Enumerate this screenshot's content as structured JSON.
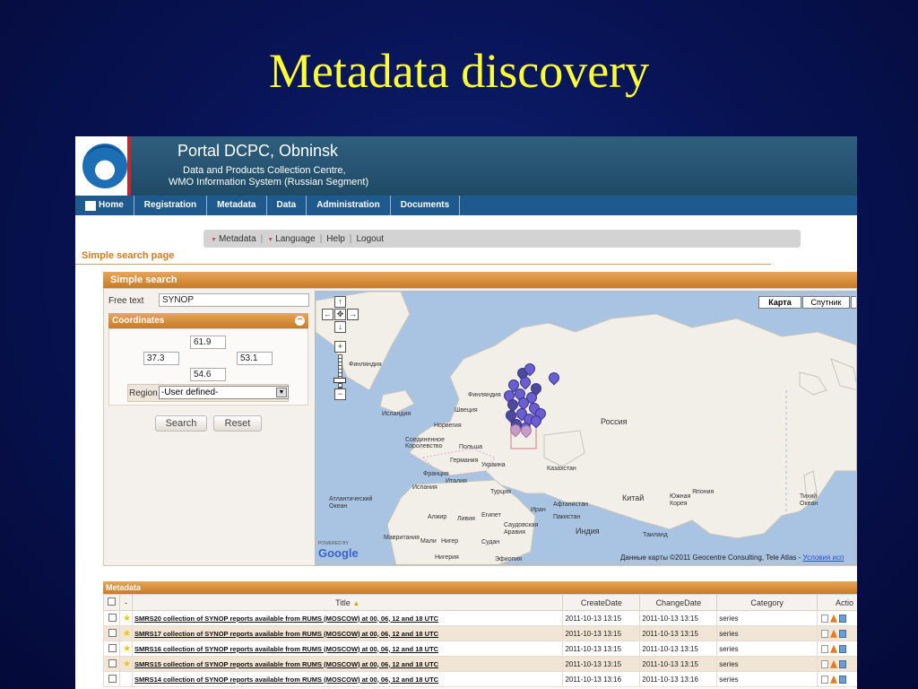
{
  "slide": {
    "title": "Metadata discovery"
  },
  "portal": {
    "title": "Portal DCPC, Obninsk",
    "subtitle1": "Data and Products Collection Centre,",
    "subtitle2": "WMO Information System (Russian Segment)"
  },
  "nav": {
    "items": [
      "Home",
      "Registration",
      "Metadata",
      "Data",
      "Administration",
      "Documents"
    ]
  },
  "toolbar": {
    "metadata": "Metadata",
    "language": "Language",
    "help": "Help",
    "logout": "Logout"
  },
  "page_heading": "Simple search page",
  "search": {
    "panel_title": "Simple search",
    "free_text_label": "Free text",
    "free_text_value": "SYNOP",
    "coordinates_title": "Coordinates",
    "north": "61.9",
    "west": "37.3",
    "east": "53.1",
    "south": "54.6",
    "region_label": "Region",
    "region_value": "-User defined-",
    "search_button": "Search",
    "reset_button": "Reset"
  },
  "map": {
    "type_map": "Карта",
    "type_satellite": "Спутник",
    "powered_by": "POWERED BY",
    "google": "Google",
    "copyright": "Данные карты ©2011 Geocentre Consulting, Tele Atlas - ",
    "terms": "Условия исп",
    "labels": {
      "russia": "Россия",
      "china": "Китай",
      "india": "Индия",
      "kazakhstan": "Казахстан",
      "turkey": "Турция",
      "iran": "Иран",
      "afghanistan": "Афганистан",
      "pakistan": "Пакистан",
      "saudi": "Саудовская Аравия",
      "egypt": "Египет",
      "libya": "Ливия",
      "algeria": "Алжир",
      "mauritania": "Мавритания",
      "mali": "Мали",
      "niger": "Нигер",
      "sudan": "Судан",
      "nigeria": "Нигерия",
      "ethiopia": "Эфиопия",
      "iceland": "Исландия",
      "norway": "Норвегия",
      "sweden": "Швеция",
      "finland": "Финляндия",
      "uk": "Соединенное Королевство",
      "poland": "Польша",
      "germany": "Германия",
      "ukraine": "Украина",
      "france": "Франция",
      "italy": "Италия",
      "spain": "Испания",
      "atlantic": "Атлантический Океан",
      "pacific": "Тихий Океан",
      "japan": "Япония",
      "south_korea": "Южная Корея",
      "thailand": "Таиланд",
      "finland_west": "Финляндия"
    }
  },
  "metadata": {
    "panel_title": "Metadata",
    "columns": [
      "-",
      "Title",
      "CreateDate",
      "ChangeDate",
      "Category",
      "Actio"
    ],
    "rows": [
      {
        "title": "SMRS20 collection of SYNOP reports available from RUMS (MOSCOW) at 00, 06, 12 and 18 UTC",
        "create": "2011-10-13 13:15",
        "change": "2011-10-13 13:15",
        "category": "series"
      },
      {
        "title": "SMRS17 collection of SYNOP reports available from RUMS (MOSCOW) at 00, 06, 12 and 18 UTC",
        "create": "2011-10-13 13:15",
        "change": "2011-10-13 13:15",
        "category": "series"
      },
      {
        "title": "SMRS16 collection of SYNOP reports available from RUMS (MOSCOW) at 00, 06, 12 and 18 UTC",
        "create": "2011-10-13 13:15",
        "change": "2011-10-13 13:15",
        "category": "series"
      },
      {
        "title": "SMRS15 collection of SYNOP reports available from RUMS (MOSCOW) at 00, 06, 12 and 18 UTC",
        "create": "2011-10-13 13:15",
        "change": "2011-10-13 13:15",
        "category": "series"
      },
      {
        "title": "SMRS14 collection of SYNOP reports available from RUMS (MOSCOW) at 00, 06, 12 and 18 UTC",
        "create": "2011-10-13 13:16",
        "change": "2011-10-13 13:16",
        "category": "series"
      }
    ]
  }
}
